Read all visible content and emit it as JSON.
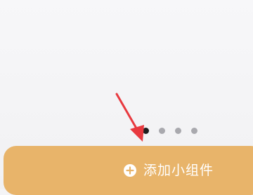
{
  "pager": {
    "count": 4,
    "active_index": 0,
    "active_color": "#1e1e1e",
    "inactive_color": "#a9a9ae"
  },
  "annotation": {
    "arrow_color": "#e8393f",
    "icon": "down-arrow-icon"
  },
  "add_widget": {
    "label": "添加小组件",
    "icon": "plus-circle-icon",
    "background": "#e8b46a",
    "text_color": "#ffffff"
  }
}
